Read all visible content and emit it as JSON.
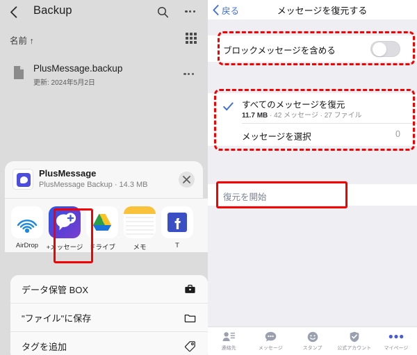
{
  "left": {
    "header": {
      "back_icon": "back-chevron-icon",
      "title": "Backup",
      "search_icon": "search-icon",
      "more_icon": "more-horizontal-icon"
    },
    "sort": {
      "label": "名前 ↑",
      "view_icon": "grid-view-icon"
    },
    "file": {
      "doc_icon": "document-icon",
      "name": "PlusMessage.backup",
      "subtitle": "更新: 2024年5月2日",
      "more_icon": "more-horizontal-icon"
    },
    "share_sheet": {
      "app_icon": "plusmessage-document-icon",
      "title": "PlusMessage",
      "subtitle": "PlusMessage Backup · 14.3 MB",
      "close_icon": "close-icon",
      "apps": [
        {
          "label": "AirDrop",
          "icon": "airdrop-icon"
        },
        {
          "label": "+メッセージ",
          "icon": "plusmessage-app-icon"
        },
        {
          "label": "ドライブ",
          "icon": "google-drive-icon"
        },
        {
          "label": "メモ",
          "icon": "notes-icon"
        },
        {
          "label": "T",
          "icon": "facebook-icon"
        }
      ],
      "actions": [
        {
          "label": "データ保管 BOX",
          "icon": "briefcase-icon"
        },
        {
          "label": "\"ファイル\"に保存",
          "icon": "folder-icon"
        },
        {
          "label": "タグを追加",
          "icon": "tag-icon"
        }
      ]
    }
  },
  "right": {
    "header": {
      "back_icon": "back-chevron-icon",
      "back_label": "戻る",
      "title": "メッセージを復元する"
    },
    "block_setting": {
      "label": "ブロックメッセージを含める",
      "toggle_state": "off"
    },
    "restore": {
      "check_icon": "checkmark-icon",
      "all_title": "すべてのメッセージを復元",
      "all_size": "11.7 MB",
      "all_detail": " · 42 メッセージ · 27 ファイル",
      "select_label": "メッセージを選択",
      "select_count": "0"
    },
    "start_button": {
      "label": "復元を開始"
    },
    "tabs": [
      {
        "label": "連絡先",
        "icon": "contacts-icon"
      },
      {
        "label": "メッセージ",
        "icon": "message-bubble-icon"
      },
      {
        "label": "スタンプ",
        "icon": "smiley-icon"
      },
      {
        "label": "公式アカウント",
        "icon": "verified-shield-icon"
      },
      {
        "label": "マイページ",
        "icon": "more-dots-icon"
      }
    ]
  },
  "annotations": {
    "highlight_color": "#f50000",
    "boxes": [
      {
        "name": "app-highlight",
        "style": "solid"
      },
      {
        "name": "block-setting-highlight",
        "style": "dashed"
      },
      {
        "name": "restore-options-highlight",
        "style": "dashed"
      },
      {
        "name": "start-button-highlight",
        "style": "solid"
      }
    ]
  }
}
